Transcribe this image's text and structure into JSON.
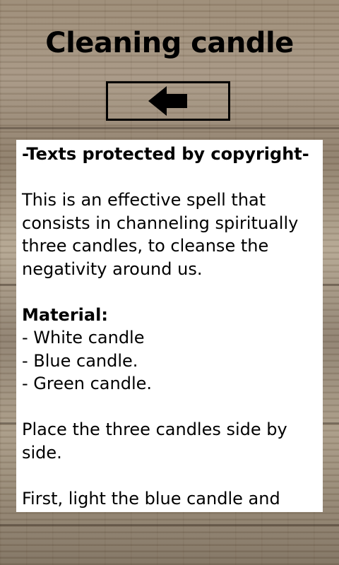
{
  "header": {
    "title": "Cleaning candle",
    "back_icon": "arrow-left-icon"
  },
  "content": {
    "copyright": " -Texts protected by copyright-",
    "intro": " This is an effective spell that consists in channeling spiritually three candles, to cleanse the negativity around us.",
    "material_heading": " Material:",
    "materials": [
      " - White candle",
      " - Blue candle.",
      " - Green candle."
    ],
    "step_1": " Place the three candles side by side.",
    "step_2": " First, light the blue candle and"
  }
}
